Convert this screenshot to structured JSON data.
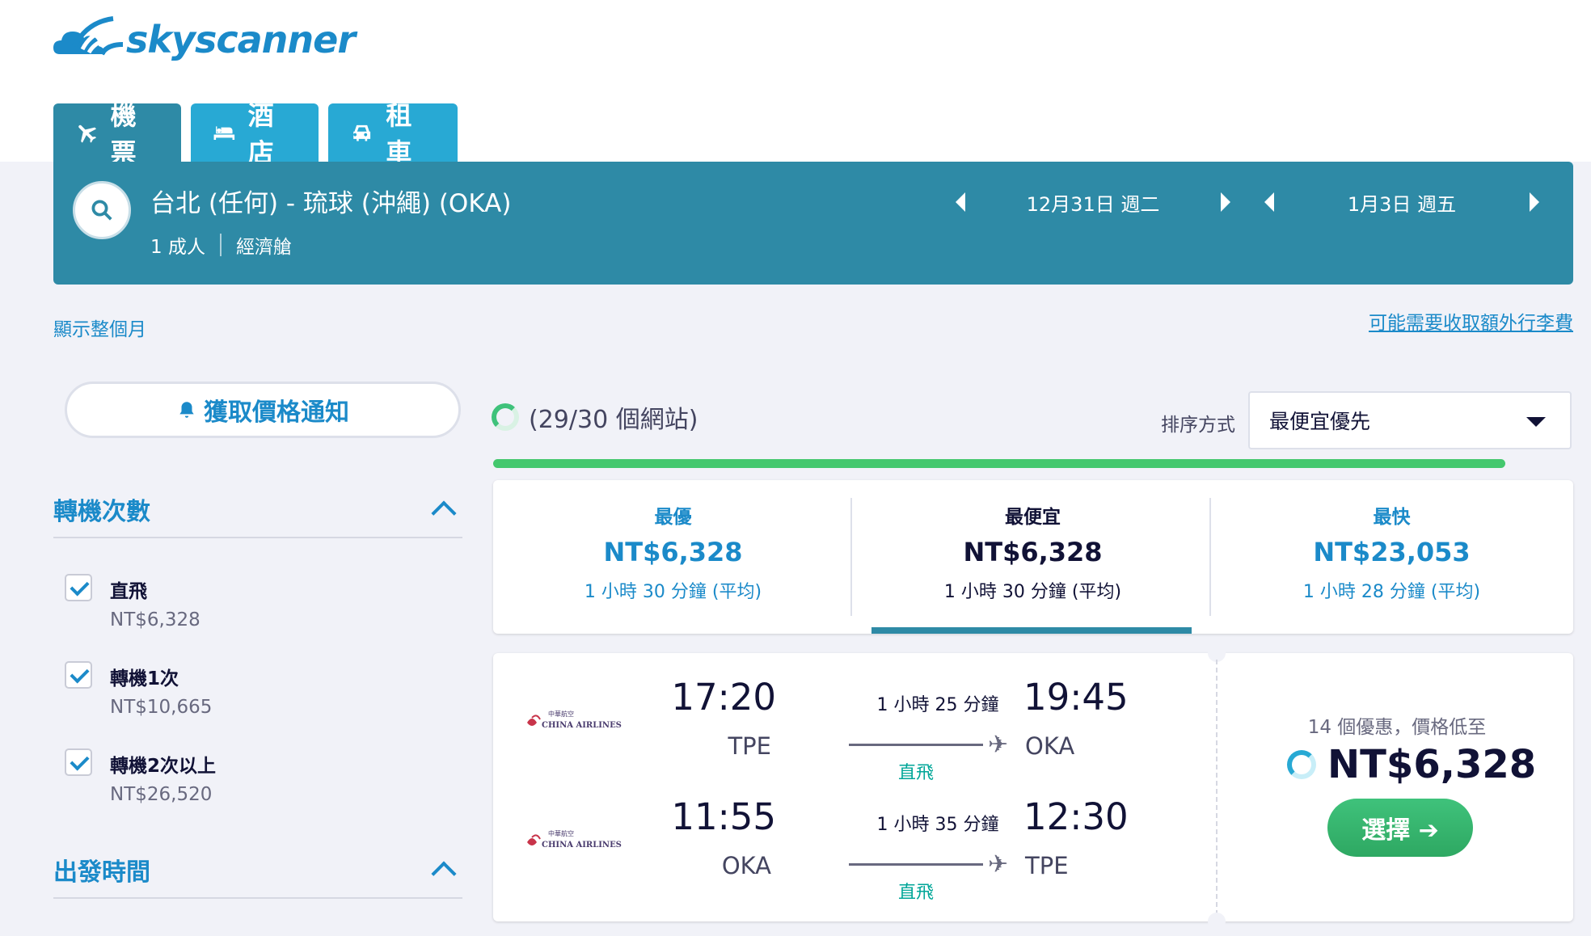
{
  "brand": {
    "name": "skyscanner",
    "color": "#1b8ac9"
  },
  "tabs": [
    {
      "label": "機票",
      "icon": "plane-icon",
      "active": true
    },
    {
      "label": "酒店",
      "icon": "bed-icon",
      "active": false
    },
    {
      "label": "租車",
      "icon": "car-icon",
      "active": false
    }
  ],
  "search": {
    "route": "台北 (任何) - 琉球 (沖繩) (OKA)",
    "passengers": "1 成人",
    "cabin": "經濟艙",
    "depart_date": "12月31日 週二",
    "return_date": "1月3日 週五"
  },
  "links": {
    "show_month": "顯示整個月",
    "baggage": "可能需要收取額外行李費"
  },
  "price_alert": {
    "label": "獲取價格通知"
  },
  "filters": {
    "stops_title": "轉機次數",
    "stops": [
      {
        "label": "直飛",
        "price": "NT$6,328",
        "checked": true
      },
      {
        "label": "轉機1次",
        "price": "NT$10,665",
        "checked": true
      },
      {
        "label": "轉機2次以上",
        "price": "NT$26,520",
        "checked": true
      }
    ],
    "departure_title": "出發時間"
  },
  "results_header": {
    "progress": "(29/30 個網站)",
    "sort_label": "排序方式",
    "sort_value": "最便宜優先",
    "load_fraction": 1.0
  },
  "summary": [
    {
      "title": "最優",
      "price": "NT$6,328",
      "duration": "1 小時 30 分鐘 (平均)"
    },
    {
      "title": "最便宜",
      "price": "NT$6,328",
      "duration": "1 小時 30 分鐘 (平均)"
    },
    {
      "title": "最快",
      "price": "NT$23,053",
      "duration": "1 小時 28 分鐘 (平均)"
    }
  ],
  "result": {
    "airline": "CHINA AIRLINES",
    "airline_cn": "中華航空",
    "legs": [
      {
        "dep_time": "17:20",
        "dep_code": "TPE",
        "duration": "1 小時 25 分鐘",
        "stops": "直飛",
        "arr_time": "19:45",
        "arr_code": "OKA"
      },
      {
        "dep_time": "11:55",
        "dep_code": "OKA",
        "duration": "1 小時 35 分鐘",
        "stops": "直飛",
        "arr_time": "12:30",
        "arr_code": "TPE"
      }
    ],
    "deals": "14 個優惠，價格低至",
    "price": "NT$6,328",
    "select_label": "選擇 ➔"
  }
}
